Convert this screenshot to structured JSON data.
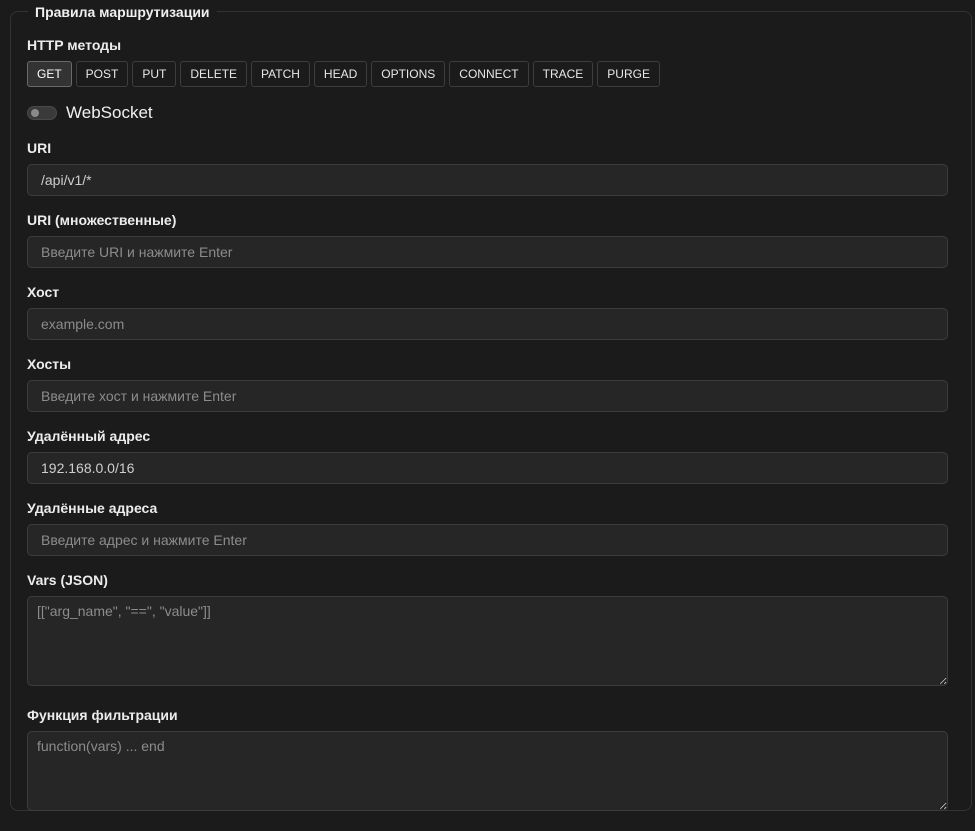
{
  "section": {
    "title": "Правила маршрутизации"
  },
  "http_methods": {
    "label": "HTTP методы",
    "items": [
      "GET",
      "POST",
      "PUT",
      "DELETE",
      "PATCH",
      "HEAD",
      "OPTIONS",
      "CONNECT",
      "TRACE",
      "PURGE"
    ],
    "selected": "GET"
  },
  "websocket": {
    "label": "WebSocket",
    "enabled": false
  },
  "uri": {
    "label": "URI",
    "value": "/api/v1/*"
  },
  "uris": {
    "label": "URI (множественные)",
    "placeholder": "Введите URI и нажмите Enter"
  },
  "host": {
    "label": "Хост",
    "placeholder": "example.com"
  },
  "hosts": {
    "label": "Хосты",
    "placeholder": "Введите хост и нажмите Enter"
  },
  "remote_addr": {
    "label": "Удалённый адрес",
    "value": "192.168.0.0/16"
  },
  "remote_addrs": {
    "label": "Удалённые адреса",
    "placeholder": "Введите адрес и нажмите Enter"
  },
  "vars": {
    "label": "Vars (JSON)",
    "placeholder": "[[\"arg_name\", \"==\", \"value\"]]"
  },
  "filter_func": {
    "label": "Функция фильтрации",
    "placeholder": "function(vars) ... end"
  }
}
